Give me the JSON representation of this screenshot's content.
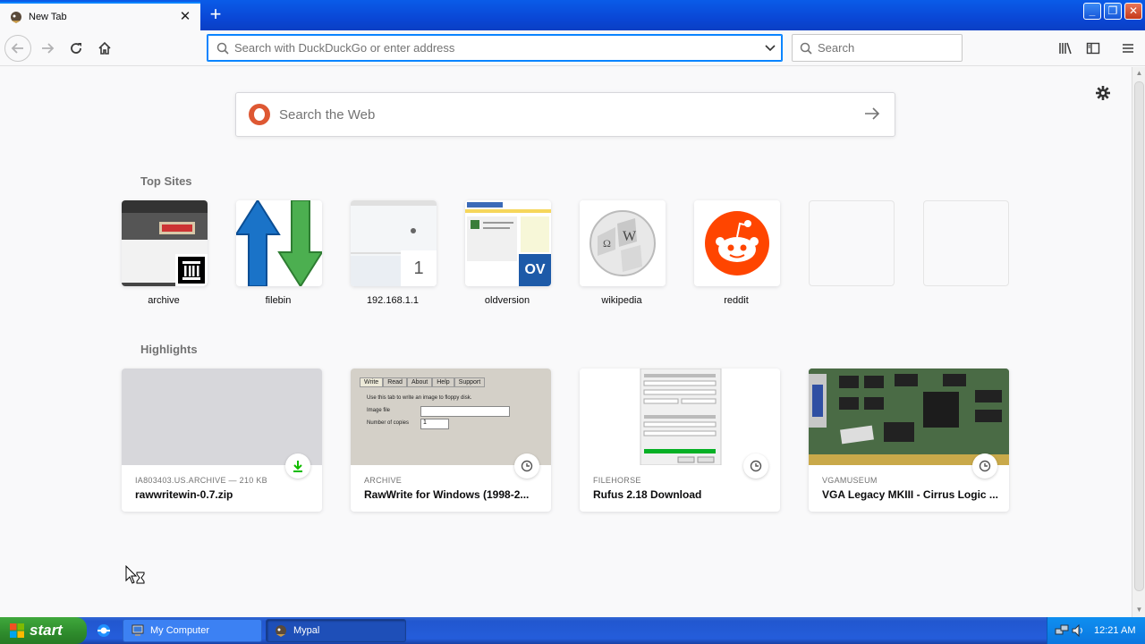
{
  "window": {
    "tab_title": "New Tab",
    "tab_close": "✕",
    "new_tab": "+",
    "min": "_",
    "max": "❐",
    "close": "✕"
  },
  "navbar": {
    "url_placeholder": "Search with DuckDuckGo or enter address",
    "search_placeholder": "Search"
  },
  "newtab": {
    "web_search_placeholder": "Search the Web",
    "top_sites_title": "Top Sites",
    "highlights_title": "Highlights",
    "top_sites": [
      {
        "label": "archive"
      },
      {
        "label": "filebin"
      },
      {
        "label": "192.168.1.1",
        "badge": "1"
      },
      {
        "label": "oldversion",
        "badge": "OV"
      },
      {
        "label": "wikipedia"
      },
      {
        "label": "reddit"
      }
    ],
    "highlights": [
      {
        "meta": "IA803403.US.ARCHIVE — 210 KB",
        "title": "rawwritewin-0.7.zip",
        "icon": "download-icon"
      },
      {
        "meta": "ARCHIVE",
        "title": "RawWrite for Windows (1998-2...",
        "icon": "clock-icon",
        "thumb": {
          "tabs": [
            "Write",
            "Read",
            "About",
            "Help",
            "Support"
          ],
          "hint": "Use this tab to write an image to floppy disk.",
          "image_file": "Image file",
          "copies_label": "Number of copies",
          "copies_value": "1"
        }
      },
      {
        "meta": "FILEHORSE",
        "title": "Rufus 2.18 Download",
        "icon": "clock-icon"
      },
      {
        "meta": "VGAMUSEUM",
        "title": "VGA Legacy MKIII - Cirrus Logic ...",
        "icon": "clock-icon"
      }
    ]
  },
  "taskbar": {
    "start": "start",
    "tasks": [
      {
        "label": "My Computer"
      },
      {
        "label": "Mypal"
      }
    ],
    "clock": "12:21 AM"
  },
  "colors": {
    "accent": "#0a84ff",
    "reddit": "#ff4500",
    "download_green": "#12bc00",
    "xp_blue": "#245ddb",
    "xp_green": "#3fa83c"
  }
}
